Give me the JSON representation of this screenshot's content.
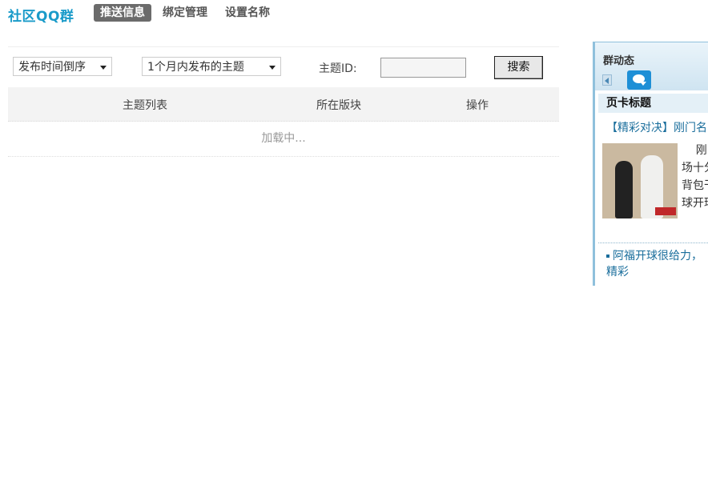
{
  "header": {
    "brand": "社区QQ群",
    "tabs": [
      {
        "label": "推送信息",
        "active": true
      },
      {
        "label": "绑定管理",
        "active": false
      },
      {
        "label": "设置名称",
        "active": false
      }
    ]
  },
  "filters": {
    "order_select": "发布时间倒序",
    "range_select": "1个月内发布的主题",
    "id_label": "主题ID:",
    "id_value": "",
    "search_button": "搜索"
  },
  "table": {
    "columns": [
      "主题列表",
      "所在版块",
      "操作"
    ],
    "loading_text": "加载中..."
  },
  "widget": {
    "title": "群动态",
    "tab_title": "页卡标题",
    "headline": "【精彩对决】刚门名",
    "feature_text": "    刚\n场十分\n背包干\n球开球",
    "link_text": "阿福开球很给力，精彩"
  },
  "colors": {
    "brand": "#1a9bc9",
    "active_tab_bg": "#6b6b6b",
    "link": "#1a6e9c",
    "widget_border": "#8fc0dc"
  }
}
